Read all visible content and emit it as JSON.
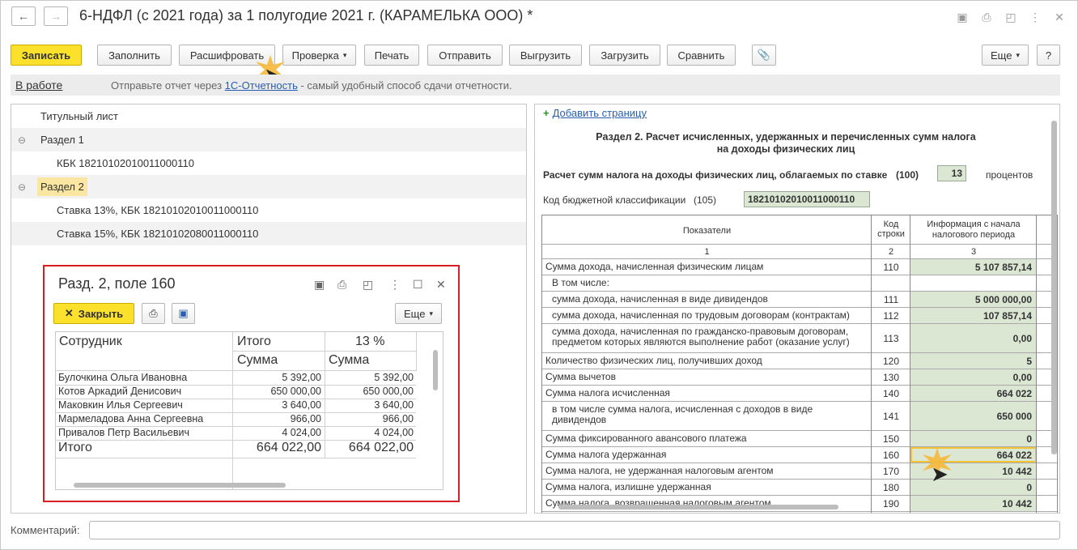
{
  "window": {
    "title": "6-НДФЛ (с 2021 года) за 1 полугодие 2021 г. (КАРАМЕЛЬКА ООО) *"
  },
  "toolbar": {
    "save": "Записать",
    "fill": "Заполнить",
    "decode": "Расшифровать",
    "check": "Проверка",
    "print": "Печать",
    "send": "Отправить",
    "export": "Выгрузить",
    "import": "Загрузить",
    "compare": "Сравнить",
    "more": "Еще",
    "help": "?"
  },
  "status": {
    "state": "В работе",
    "msg_before": "Отправьте отчет через ",
    "link": "1С-Отчетность",
    "msg_after": " - самый удобный способ сдачи отчетности."
  },
  "tree": [
    "Титульный лист",
    "Раздел 1",
    "КБК 18210102010011000110",
    "Раздел 2",
    "Ставка 13%, КБК 18210102010011000110",
    "Ставка 15%, КБК 18210102080011000110"
  ],
  "popup": {
    "title": "Разд. 2, поле 160",
    "close": "Закрыть",
    "more": "Еще",
    "headers": {
      "employee": "Сотрудник",
      "total": "Итого",
      "rate": "13 %",
      "sum1": "Сумма",
      "sum2": "Сумма"
    },
    "rows": [
      {
        "name": "Булочкина Ольга Ивановна",
        "total": "5 392,00",
        "rate": "5 392,00"
      },
      {
        "name": "Котов Аркадий Денисович",
        "total": "650 000,00",
        "rate": "650 000,00"
      },
      {
        "name": "Маковкин Илья Сергеевич",
        "total": "3 640,00",
        "rate": "3 640,00"
      },
      {
        "name": "Мармеладова Анна Сергеевна",
        "total": "966,00",
        "rate": "966,00"
      },
      {
        "name": "Привалов Петр Васильевич",
        "total": "4 024,00",
        "rate": "4 024,00"
      }
    ],
    "footer": {
      "label": "Итого",
      "total": "664 022,00",
      "rate": "664 022,00"
    }
  },
  "report": {
    "add_page": "Добавить страницу",
    "section_title_1": "Раздел 2. Расчет исчисленных, удержанных и перечисленных сумм налога",
    "section_title_2": "на доходы физических лиц",
    "rate_label": "Расчет сумм налога на доходы физических лиц, облагаемых по ставке",
    "rate_code": "(100)",
    "rate_value": "13",
    "rate_unit": "процентов",
    "kbk_label": "Код бюджетной классификации",
    "kbk_code": "(105)",
    "kbk_value": "18210102010011000110",
    "col1": "Показатели",
    "col2": "Код строки",
    "col3": "Информация с начала налогового периода",
    "num1": "1",
    "num2": "2",
    "num3": "3",
    "rows": [
      {
        "label": "Сумма дохода, начисленная физическим лицам",
        "code": "110",
        "value": "5 107 857,14"
      },
      {
        "label": "В том числе:",
        "code": "",
        "value": ""
      },
      {
        "label": "сумма дохода, начисленная в виде дивидендов",
        "code": "111",
        "value": "5 000 000,00"
      },
      {
        "label": "сумма дохода, начисленная по трудовым договорам (контрактам)",
        "code": "112",
        "value": "107 857,14"
      },
      {
        "label": "сумма дохода, начисленная по гражданско-правовым договорам,",
        "label2": "предметом которых являются выполнение работ (оказание услуг)",
        "code": "113",
        "value": "0,00"
      },
      {
        "label": "Количество физических лиц, получивших доход",
        "code": "120",
        "value": "5"
      },
      {
        "label": "Сумма вычетов",
        "code": "130",
        "value": "0,00"
      },
      {
        "label": "Сумма налога исчисленная",
        "code": "140",
        "value": "664 022"
      },
      {
        "label": "в том числе сумма налога, исчисленная с доходов в виде",
        "label2": "дивидендов",
        "code": "141",
        "value": "650 000"
      },
      {
        "label": "Сумма фиксированного авансового платежа",
        "code": "150",
        "value": "0"
      },
      {
        "label": "Сумма налога удержанная",
        "code": "160",
        "value": "664 022"
      },
      {
        "label": "Сумма налога, не удержанная налоговым агентом",
        "code": "170",
        "value": "10 442"
      },
      {
        "label": "Сумма налога, излишне удержанная",
        "code": "180",
        "value": "0"
      },
      {
        "label": "Сумма налога, возвращенная налоговым агентом",
        "code": "190",
        "value": "10 442"
      }
    ]
  },
  "comment": {
    "label": "Комментарий:"
  }
}
